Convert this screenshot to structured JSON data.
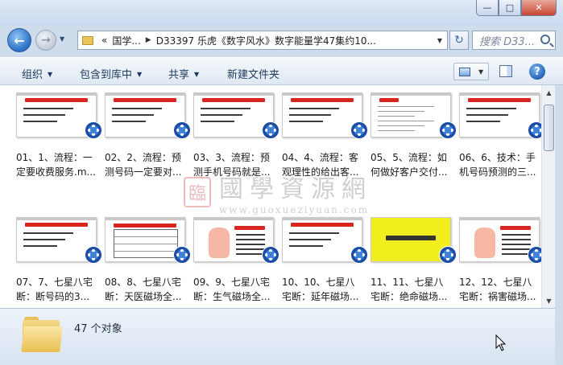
{
  "window": {
    "controls": {
      "minimize": "—",
      "maximize": "□",
      "close": "✕"
    }
  },
  "nav": {
    "address_prefix": "«",
    "address_segments": [
      "国学...",
      "D33397 乐虎《数字风水》数字能量学47集约10..."
    ],
    "search_placeholder": "搜索 D33...",
    "icons": [
      "back-arrow-icon",
      "forward-arrow-icon",
      "refresh-icon",
      "search-icon"
    ]
  },
  "toolbar": {
    "organize": "组织",
    "include_in_library": "包含到库中",
    "share": "共享",
    "new_folder": "新建文件夹"
  },
  "watermark": {
    "seal": "臨",
    "text": "國學資源網",
    "url": "www.guoxueziyuan.com"
  },
  "files": [
    {
      "label_line1": "01、1、流程：一",
      "label_line2": "定要收费服务.m...",
      "thumb": "slide"
    },
    {
      "label_line1": "02、2、流程：预",
      "label_line2": "测号码一定要对...",
      "thumb": "slide"
    },
    {
      "label_line1": "03、3、流程：预",
      "label_line2": "测手机号码就是...",
      "thumb": "slide-red"
    },
    {
      "label_line1": "04、4、流程：客",
      "label_line2": "观理性的给出客...",
      "thumb": "slide"
    },
    {
      "label_line1": "05、5、流程：如",
      "label_line2": "何做好客户交付...",
      "thumb": "doc"
    },
    {
      "label_line1": "06、6、技术：手",
      "label_line2": "机号码预测的三...",
      "thumb": "slide"
    },
    {
      "label_line1": "07、7、七星八宅",
      "label_line2": "断：断号码的3...",
      "thumb": "slide"
    },
    {
      "label_line1": "08、8、七星八宅",
      "label_line2": "断：天医磁场全...",
      "thumb": "table"
    },
    {
      "label_line1": "09、9、七星八宅",
      "label_line2": "断：生气磁场全...",
      "thumb": "palm"
    },
    {
      "label_line1": "10、10、七星八",
      "label_line2": "宅断：延年磁场...",
      "thumb": "slide"
    },
    {
      "label_line1": "11、11、七星八",
      "label_line2": "宅断：绝命磁场...",
      "thumb": "yellow"
    },
    {
      "label_line1": "12、12、七星八",
      "label_line2": "宅断：祸害磁场...",
      "thumb": "palm"
    }
  ],
  "details": {
    "count": "47 个对象"
  }
}
